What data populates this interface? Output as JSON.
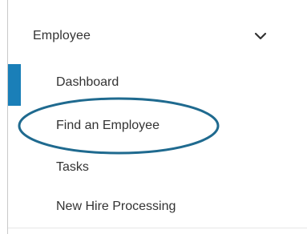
{
  "sidebar": {
    "section": {
      "title": "Employee",
      "icon": "chevron-down-icon"
    },
    "items": [
      {
        "label": "Dashboard"
      },
      {
        "label": "Find an Employee"
      },
      {
        "label": "Tasks"
      },
      {
        "label": "New Hire Processing"
      }
    ],
    "accent_color": "#1a7fb8",
    "highlight_color": "#1f6a8f"
  }
}
